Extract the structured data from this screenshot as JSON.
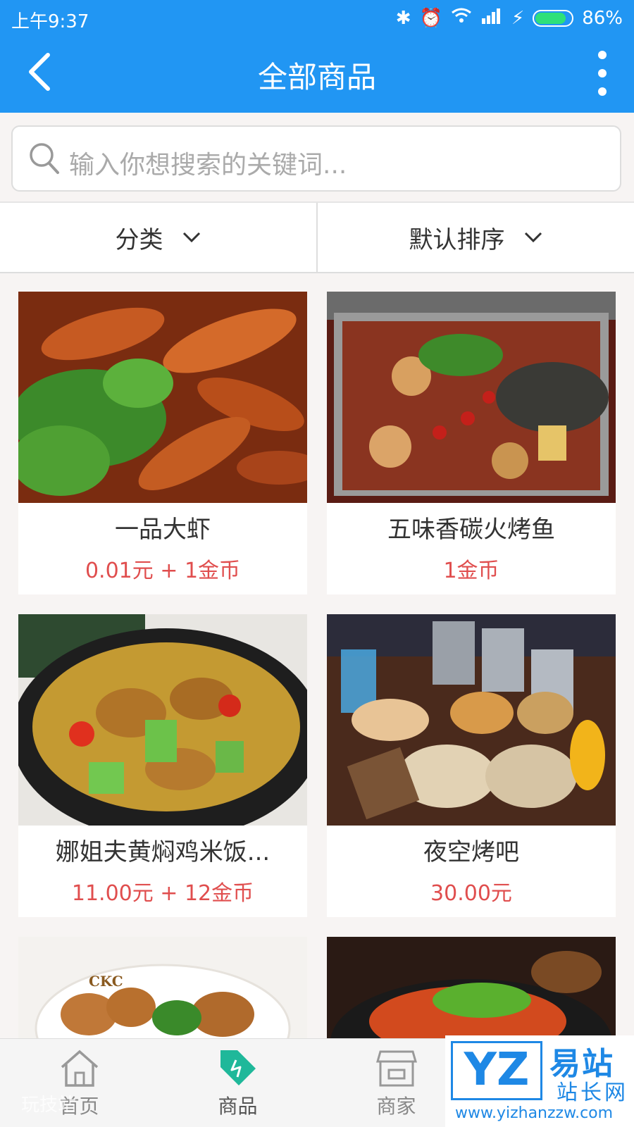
{
  "status_bar": {
    "time": "上午9:37",
    "battery": "86%"
  },
  "header": {
    "title": "全部商品"
  },
  "search": {
    "placeholder": "输入你想搜索的关键词..."
  },
  "filters": {
    "category": "分类",
    "sort": "默认排序"
  },
  "products": [
    {
      "name": "一品大虾",
      "price": "0.01元 + 1金币"
    },
    {
      "name": "五味香碳火烤鱼",
      "price": "1金币"
    },
    {
      "name": "娜姐夫黄焖鸡米饭...",
      "price": "11.00元 + 12金币"
    },
    {
      "name": "夜空烤吧",
      "price": "30.00元"
    }
  ],
  "partial_image_text": "CKC",
  "tabbar": {
    "home": "首页",
    "goods": "商品",
    "shops": "商家"
  },
  "watermark": {
    "logo": "YZ",
    "name": "易站",
    "sub": "站长网",
    "url": "www.yizhanzzw.com",
    "left_text": "玩技站"
  },
  "colors": {
    "primary": "#2196f3",
    "price": "#e04e4e",
    "active_tab": "#1fb89a"
  }
}
